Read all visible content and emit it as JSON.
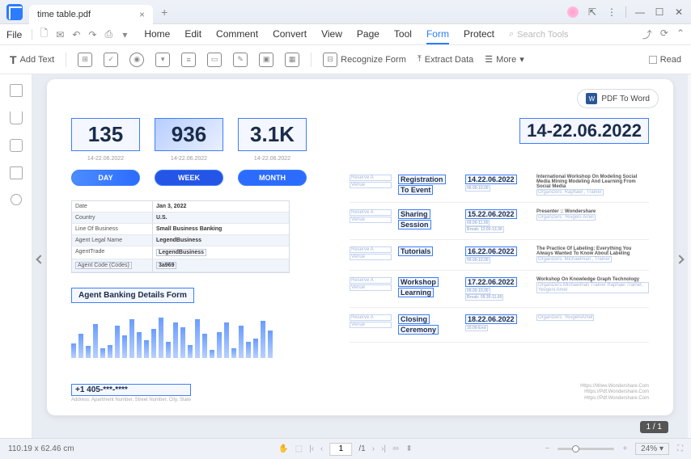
{
  "tab": {
    "title": "time table.pdf"
  },
  "menubar": {
    "file": "File",
    "items": [
      "Home",
      "Edit",
      "Comment",
      "Convert",
      "View",
      "Page",
      "Tool",
      "Form",
      "Protect"
    ],
    "active": "Form",
    "search_placeholder": "Search Tools"
  },
  "toolbar": {
    "add_text": "Add Text",
    "recognize": "Recognize Form",
    "extract": "Extract Data",
    "more": "More",
    "read": "Read"
  },
  "pdf_word_btn": "PDF To Word",
  "stats": [
    {
      "value": "135",
      "date": "14-22.06.2022",
      "label": "DAY",
      "cls": "day"
    },
    {
      "value": "936",
      "date": "14-22.06.2022",
      "label": "WEEK",
      "cls": "week"
    },
    {
      "value": "3.1K",
      "date": "14-22.06.2022",
      "label": "MONTH",
      "cls": "month"
    }
  ],
  "date_title": "14-22.06.2022",
  "form_rows": [
    {
      "l": "Date",
      "r": "Jan 3, 2022"
    },
    {
      "l": "Country",
      "r": "U.S."
    },
    {
      "l": "Line Of Business",
      "r": "Small Business Banking"
    },
    {
      "l": "Agent Legal Name",
      "r": "LegendBusiness"
    },
    {
      "l": "AgentTrade",
      "r": "LegendBusiness"
    },
    {
      "l": "Agent Code (Codes)",
      "r": "3a969"
    }
  ],
  "chart_title": "Agent Banking Details Form",
  "events": [
    {
      "title": [
        "Registration",
        "To Event"
      ],
      "date": "14.22.06.2022",
      "times": [
        "06.00-10.00"
      ],
      "desc": "International Workshop On Modeling Social Media Mining Modeling And Learning From Social Media",
      "sub": "Organizers: Raphael , Trainer"
    },
    {
      "title": [
        "Sharing",
        "Session"
      ],
      "date": "15.22.06.2022",
      "times": [
        "09.00-11.00",
        "Break: 13.00-13.30"
      ],
      "desc": "Presenter :: Wondershare",
      "sub": "Organizers: Yevgeni Amel"
    },
    {
      "title": [
        "Tutorials"
      ],
      "date": "16.22.06.2022",
      "times": [
        "09.00-10.00"
      ],
      "desc": "The Practice Of Labeling: Everything You Always Wanted To Know About Labeling",
      "sub": "Organizers: Michaelmari , Trainer"
    },
    {
      "title": [
        "Workshop",
        "Learning"
      ],
      "date": "17.22.06.2022",
      "times": [
        "09.00-10.00",
        "Break: 09.30-11.00"
      ],
      "desc": "Workshop On Knowledge Graph Technology",
      "sub": "Organizers:Michaelmari Trainer Raphael Trainer, Yevgeni Amel"
    },
    {
      "title": [
        "Closing",
        "Ceremony"
      ],
      "date": "18.22.06.2022",
      "times": [
        "10.00-End"
      ],
      "desc": "",
      "sub": "Organizers: YevgeniAmel"
    }
  ],
  "phone": "+1 405-***-****",
  "address": "Address: Apartment Number, Street Number, City, State",
  "urls": [
    "Https://Www.Wondershare.Com",
    "Https://Pdf.Wondershare.Com",
    "Https://Pdf.Wondershare.Com"
  ],
  "page_indicator": "1 / 1",
  "status": {
    "coords": "110.19 x 62.46 cm",
    "page": "1",
    "total": "/1",
    "zoom": "24%"
  },
  "chart_data": {
    "type": "bar",
    "values": [
      18,
      30,
      15,
      42,
      12,
      16,
      40,
      28,
      48,
      32,
      22,
      36,
      50,
      20,
      44,
      38,
      16,
      48,
      30,
      10,
      32,
      44,
      12,
      40,
      20,
      24,
      46,
      34
    ],
    "title": "Agent Banking Details Form"
  }
}
